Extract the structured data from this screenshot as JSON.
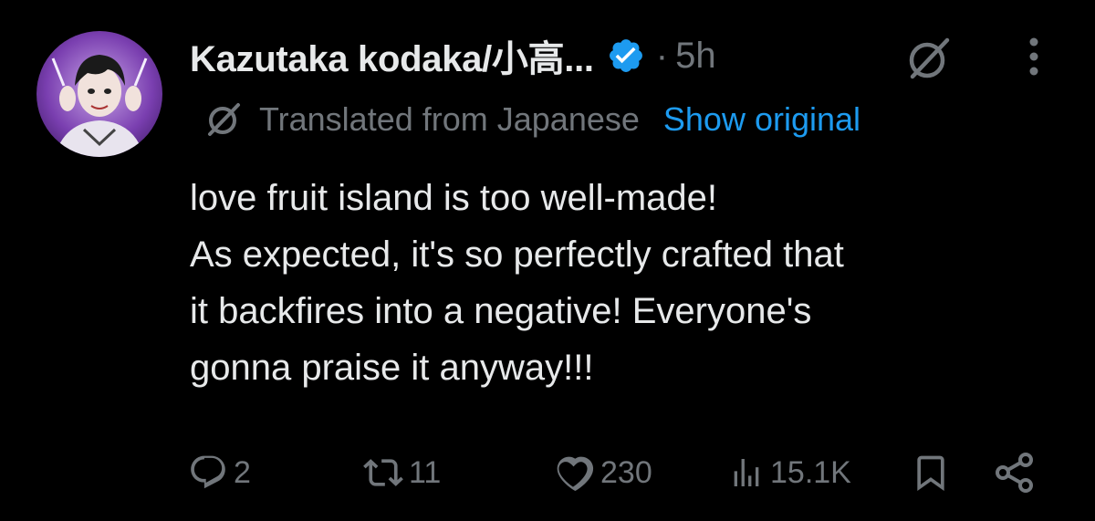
{
  "post": {
    "author": {
      "display_name": "Kazutaka kodaka/小高...",
      "verified": true,
      "avatar_icon": "user-avatar"
    },
    "separator": "·",
    "timestamp": "5h",
    "translation": {
      "label": "Translated from Japanese",
      "show_original": "Show original"
    },
    "body_lines": [
      "love fruit island is too well-made!",
      "As expected, it's so perfectly crafted that",
      "it backfires into a negative! Everyone's",
      "gonna praise it anyway!!!"
    ],
    "metrics": {
      "replies": "2",
      "reposts": "11",
      "likes": "230",
      "views": "15.1K"
    }
  },
  "colors": {
    "background": "#000000",
    "primary_text": "#e7e9ea",
    "secondary_text": "#71767b",
    "link": "#1d9bf0",
    "verified_badge": "#1d9bf0"
  },
  "icons": {
    "grok": "grok-icon",
    "more": "more-icon",
    "reply": "reply-icon",
    "repost": "repost-icon",
    "like": "like-icon",
    "views": "views-icon",
    "bookmark": "bookmark-icon",
    "share": "share-icon"
  }
}
